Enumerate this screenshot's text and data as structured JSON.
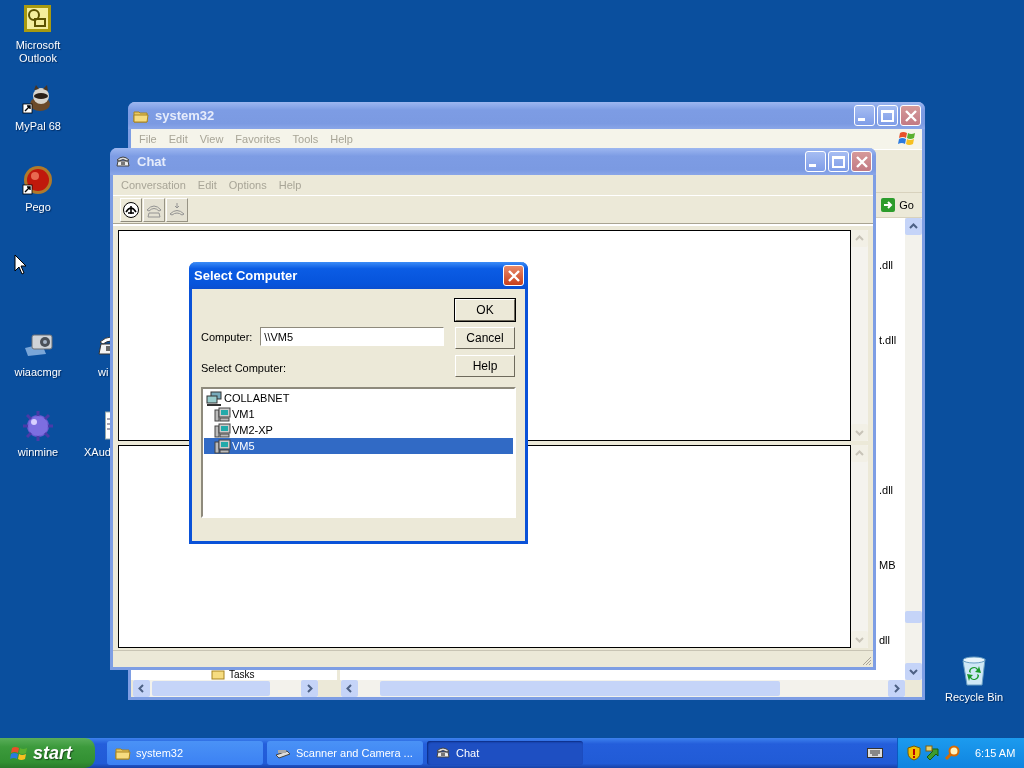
{
  "desktop_icons": [
    {
      "label": "Microsoft Outlook",
      "kind": "mail",
      "shortcut": false
    },
    {
      "label": "MyPal 68",
      "kind": "animal",
      "shortcut": true
    },
    {
      "label": "Pego",
      "kind": "ball",
      "shortcut": true
    },
    {
      "label": "wiaacmgr",
      "kind": "camera",
      "shortcut": false
    },
    {
      "label": "wi",
      "kind": "phone",
      "shortcut": false
    },
    {
      "label": "winmine",
      "kind": "mine",
      "shortcut": false
    },
    {
      "label": "XAud",
      "kind": "document",
      "shortcut": false
    },
    {
      "label": "Recycle Bin",
      "kind": "bin",
      "shortcut": false
    }
  ],
  "explorer_window": {
    "title": "system32",
    "active": false,
    "menu": [
      {
        "label": "File",
        "disabled": true
      },
      {
        "label": "Edit",
        "disabled": true
      },
      {
        "label": "View",
        "disabled": true
      },
      {
        "label": "Favorites",
        "disabled": true
      },
      {
        "label": "Tools",
        "disabled": true
      },
      {
        "label": "Help",
        "disabled": true
      }
    ],
    "go_button": "Go",
    "file_names": [
      ".dll",
      "t.dll",
      ".dll",
      "MB",
      "dll"
    ],
    "folder_item": "Tasks"
  },
  "chat_window": {
    "title": "Chat",
    "active": false,
    "menu": [
      {
        "label": "Conversation",
        "disabled": true
      },
      {
        "label": "Edit",
        "disabled": true
      },
      {
        "label": "Options",
        "disabled": true
      },
      {
        "label": "Help",
        "disabled": true
      }
    ],
    "toolbar": [
      {
        "kind": "dial",
        "disabled": false
      },
      {
        "kind": "answer",
        "disabled": true
      },
      {
        "kind": "hangup",
        "disabled": true
      }
    ]
  },
  "dialog": {
    "title": "Select Computer",
    "active": true,
    "computer_label": "Computer:",
    "computer_value": "\\\\VM5",
    "list_label": "Select Computer:",
    "buttons": [
      "OK",
      "Cancel",
      "Help"
    ],
    "tree": [
      {
        "label": "COLLABNET",
        "kind": "network",
        "selected": false,
        "children": [
          {
            "label": "VM1",
            "kind": "computer",
            "selected": false
          },
          {
            "label": "VM2-XP",
            "kind": "computer",
            "selected": false
          },
          {
            "label": "VM5",
            "kind": "computer",
            "selected": true
          }
        ]
      }
    ]
  },
  "taskbar": {
    "start": "start",
    "tasks": [
      {
        "label": "system32",
        "kind": "folder",
        "selected": false
      },
      {
        "label": "Scanner and Camera ...",
        "kind": "scanner",
        "selected": false
      },
      {
        "label": "Chat",
        "kind": "phone",
        "selected": true
      }
    ],
    "clock": "6:15 AM"
  }
}
